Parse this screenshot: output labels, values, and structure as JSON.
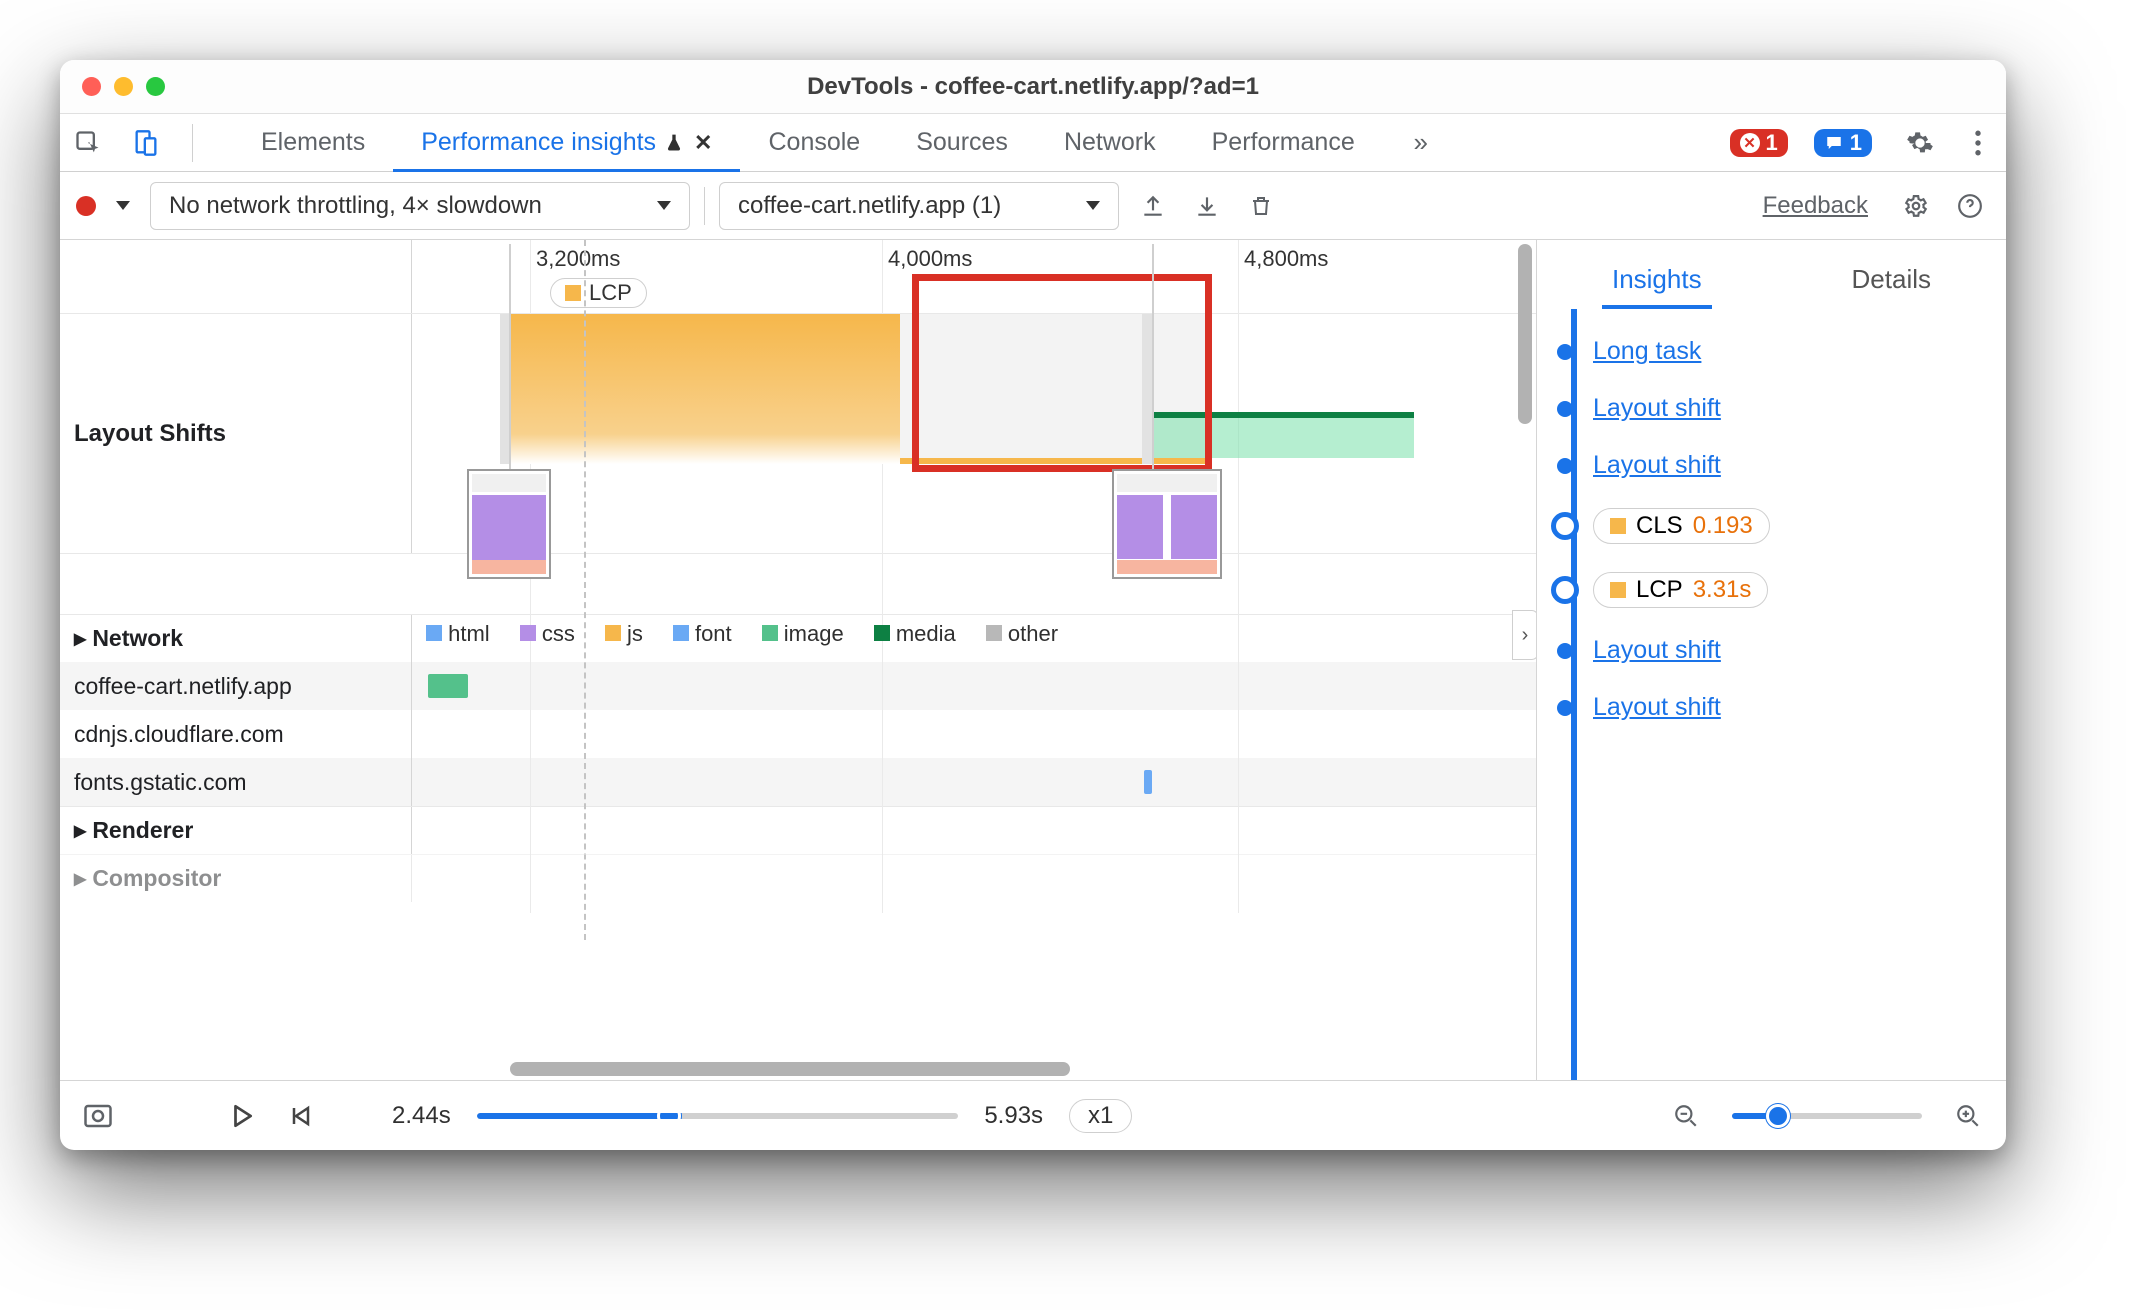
{
  "window": {
    "title": "DevTools - coffee-cart.netlify.app/?ad=1"
  },
  "tabs": {
    "elements": "Elements",
    "perf_insights": "Performance insights",
    "console": "Console",
    "sources": "Sources",
    "network": "Network",
    "performance": "Performance",
    "close_x": "✕",
    "more": "»",
    "err_count": "1",
    "msg_count": "1"
  },
  "toolbar": {
    "throttle": "No network throttling, 4× slowdown",
    "target": "coffee-cart.netlify.app (1)",
    "feedback": "Feedback"
  },
  "timeline": {
    "ticks": [
      "3,200ms",
      "4,000ms",
      "4,800ms"
    ],
    "lcp_badge": "LCP",
    "layout_shifts_label": "Layout Shifts",
    "network_label": "Network",
    "renderer_label": "Renderer",
    "compositor_label": "Compositor",
    "legend": {
      "html": "html",
      "css": "css",
      "js": "js",
      "font": "font",
      "image": "image",
      "media": "media",
      "other": "other"
    },
    "hosts": [
      "coffee-cart.netlify.app",
      "cdnjs.cloudflare.com",
      "fonts.gstatic.com"
    ]
  },
  "right": {
    "insights_tab": "Insights",
    "details_tab": "Details",
    "items": {
      "long_task": "Long task",
      "layout_shift": "Layout shift",
      "cls_label": "CLS",
      "cls_value": "0.193",
      "lcp_label": "LCP",
      "lcp_value": "3.31s"
    }
  },
  "footer": {
    "start": "2.44s",
    "end": "5.93s",
    "speed": "x1"
  },
  "colors": {
    "html": "#6aa9f4",
    "css": "#b48ee6",
    "js": "#f6b74b",
    "font": "#6aa9f4",
    "image": "#54c18b",
    "media": "#0d8043",
    "other": "#b8b8b8",
    "accent": "#1a73e8",
    "error": "#d93025",
    "cls": "#e8710a",
    "lcp": "#f6b74b"
  }
}
